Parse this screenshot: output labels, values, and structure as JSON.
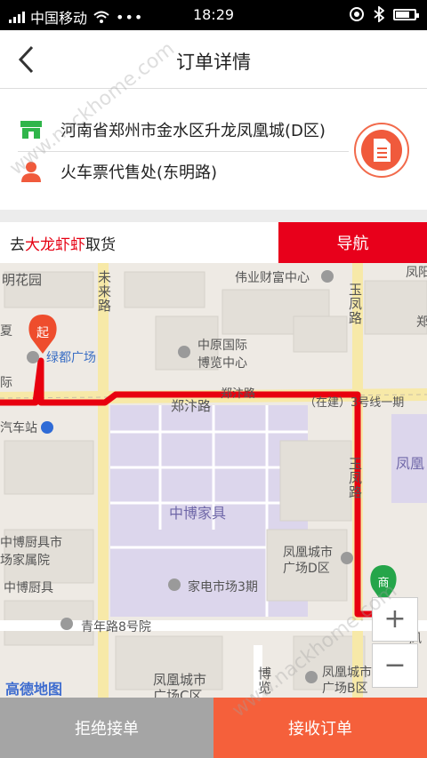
{
  "status_bar": {
    "carrier": "中国移动",
    "time": "18:29"
  },
  "header": {
    "title": "订单详情"
  },
  "order": {
    "pickup_address": "河南省郑州市金水区升龙凤凰城(D区)",
    "customer_location": "火车票代售处(东明路)"
  },
  "pickup": {
    "prefix": "去",
    "shop_name": "大龙虾虾",
    "suffix": "取货"
  },
  "nav_button": "导航",
  "map": {
    "start_marker": "起",
    "end_marker": "商",
    "logo": "高德地图",
    "labels": {
      "minghuayuan": "明花园",
      "weilai_road": "未来路",
      "weiye": "伟业财富中心",
      "yufeng_road_top": "玉凤路",
      "fengyang": "凤阳",
      "zheng": "郑",
      "xia": "夏",
      "ludu": "绿都广场",
      "zhongyuan1": "中原国际",
      "zhongyuan2": "博览中心",
      "ji": "际",
      "zhengbian_road1": "郑汴路",
      "zhengbian_road2": "郑汴路",
      "metro": "（在建）3号线一期",
      "bus_station": "汽车站",
      "yufeng_road_mid": "玉凤路",
      "fenghuang_right": "凤凰",
      "zhongbo_furniture": "中博家具",
      "zhongbo_kitchen1": "中博厨具市",
      "zhongbo_kitchen2": "场家属院",
      "zhongbo_kitchen3": "中博厨具",
      "fenghuang_d1": "凤凰城市",
      "fenghuang_d2": "广场D区",
      "appliance": "家电市场3期",
      "qingnian": "青年路8号院",
      "fenghuang_c1": "凤凰城市",
      "fenghuang_c2": "广场C区",
      "bolan_road": "博览",
      "fenghuang_b1": "凤凰城市",
      "fenghuang_b2": "广场B区",
      "feng_right": "凤"
    }
  },
  "zoom": {
    "in": "+",
    "out": "−"
  },
  "actions": {
    "reject": "拒绝接单",
    "accept": "接收订单"
  },
  "watermark": "www.nackhome.com",
  "colors": {
    "nav_red": "#e8001b",
    "accept_orange": "#f5603b",
    "reject_gray": "#a5a5a5",
    "route_red": "#e8000f",
    "shop_green": "#2fb54a",
    "user_orange": "#f05a3c"
  }
}
